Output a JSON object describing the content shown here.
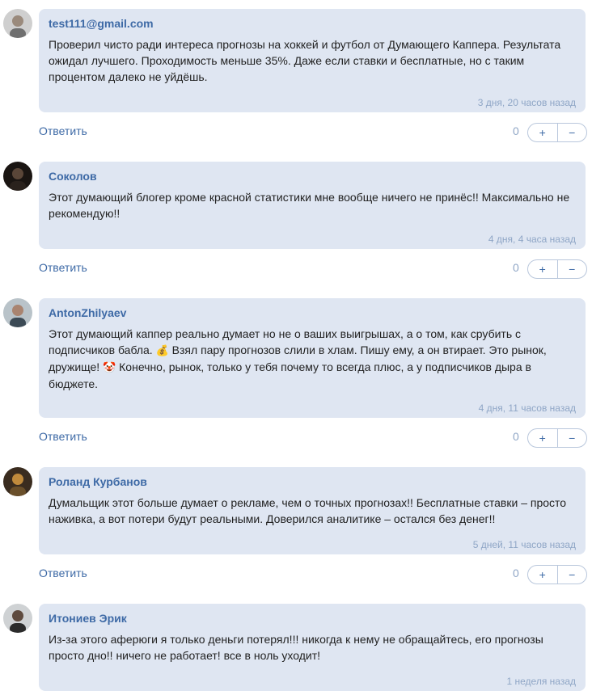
{
  "ui": {
    "reply_label": "Ответить",
    "plus_label": "+",
    "minus_label": "−"
  },
  "comments": [
    {
      "author": "test111@gmail.com",
      "text": "Проверил чисто ради интереса прогнозы на хоккей и футбол от Думающего Каппера. Результата ожидал лучшего. Проходимость меньше 35%. Даже если ставки и бесплатные, но с таким процентом далеко не уйдёшь.",
      "time": "3 дня, 20 часов назад",
      "votes": "0"
    },
    {
      "author": "Соколов",
      "text": "Этот думающий блогер кроме красной статистики мне вообще ничего не принёс!! Максимально не рекомендую!!",
      "time": "4 дня, 4 часа назад",
      "votes": "0"
    },
    {
      "author": "AntonZhilyaev",
      "text_part1": "Этот думающий каппер реально думает но не о ваших выигрышах, а о том, как срубить с подписчиков бабла. ",
      "emoji1": "💰",
      "text_part2": " Взял пару прогнозов слили в хлам. Пишу ему, а он втирает. Это рынок, дружище! ",
      "emoji2": "🤡",
      "text_part3": " Конечно, рынок, только у тебя почему то всегда плюс, а у подписчиков дыра в бюджете.",
      "time": "4 дня, 11 часов назад",
      "votes": "0"
    },
    {
      "author": "Роланд Курбанов",
      "text": "Думальщик этот больше думает о рекламе, чем о точных прогнозах!! Бесплатные ставки – просто наживка, а вот потери будут реальными. Доверился аналитике – остался без денег!!",
      "time": "5 дней, 11 часов назад",
      "votes": "0"
    },
    {
      "author": "Итониев Эрик",
      "text": "Из-за этого аферюги я только деньги потерял!!! никогда к нему не обращайтесь, его прогнозы просто дно!! ничего не работает! все в ноль уходит!",
      "time": "1 неделя назад"
    }
  ]
}
